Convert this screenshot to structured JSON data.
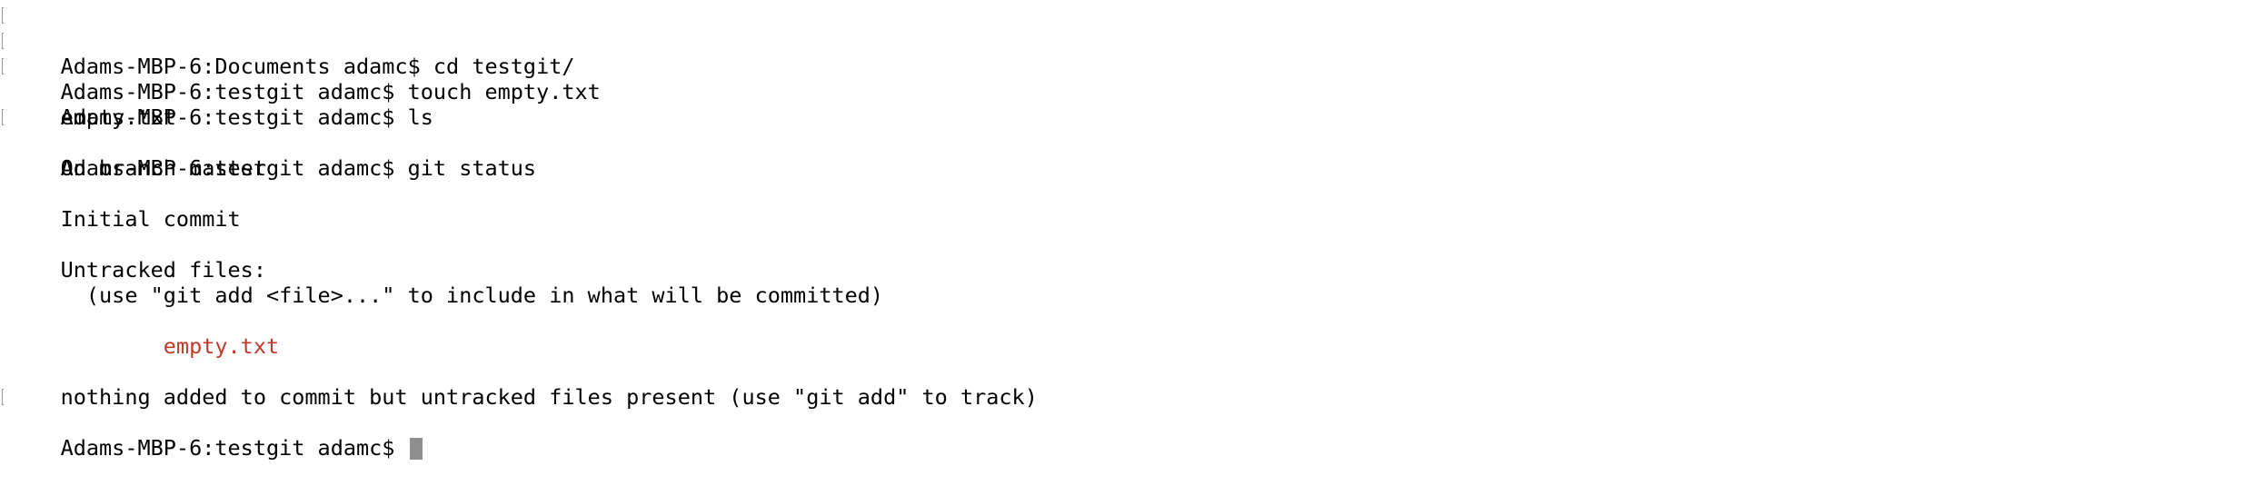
{
  "terminal": {
    "lines": [
      {
        "text": "Adams-MBP-6:Documents adamc$ cd testgit/"
      },
      {
        "text": "Adams-MBP-6:testgit adamc$ touch empty.txt"
      },
      {
        "text": "Adams-MBP-6:testgit adamc$ ls"
      },
      {
        "text": "empty.txt"
      },
      {
        "text": "Adams-MBP-6:testgit adamc$ git status"
      },
      {
        "text": "On branch master"
      },
      {
        "text": ""
      },
      {
        "text": "Initial commit"
      },
      {
        "text": ""
      },
      {
        "text": "Untracked files:"
      },
      {
        "text": "  (use \"git add <file>...\" to include in what will be committed)"
      },
      {
        "text": ""
      },
      {
        "text": "        empty.txt"
      },
      {
        "text": ""
      },
      {
        "text": "nothing added to commit but untracked files present (use \"git add\" to track)"
      },
      {
        "text": "Adams-MBP-6:testgit adamc$ "
      }
    ]
  },
  "colors": {
    "text": "#000000",
    "untracked_file": "#c0392b",
    "cursor": "#8e8e8e",
    "background": "#ffffff"
  }
}
